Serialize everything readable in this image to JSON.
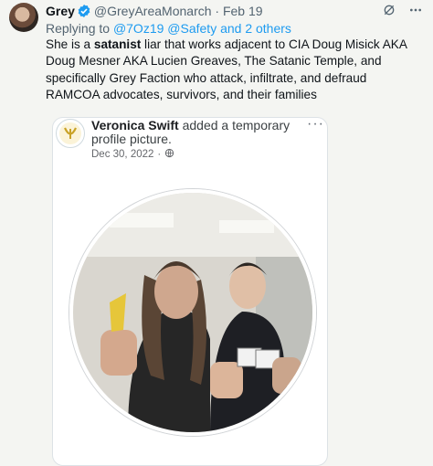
{
  "tweet": {
    "display_name": "Grey",
    "handle": "@GreyAreaMonarch",
    "separator": "·",
    "date": "Feb 19",
    "replying_prefix": "Replying to",
    "replying_targets": "@7Oz19 @Safety and 2 others",
    "text_before": "She is a ",
    "text_bold": "satanist",
    "text_after": " liar that works adjacent to CIA Doug Misick AKA Doug Mesner AKA Lucien Greaves, The Satanic Temple, and specifically Grey Faction who attack, infiltrate, and defraud RAMCOA advocates, survivors, and their families"
  },
  "embedded_post": {
    "author": "Veronica Swift",
    "action_line1": "added a temporary",
    "action_line2": "profile picture.",
    "date": "Dec 30, 2022",
    "separator": "·",
    "more": "···"
  },
  "colors": {
    "background": "#f4f5f2",
    "link": "#1d9bf0",
    "verified": "#1d9bf0",
    "secondary_text": "#536471"
  },
  "icons": [
    "verified-badge-icon",
    "grok-icon",
    "more-icon",
    "globe-icon",
    "emblem-icon"
  ]
}
